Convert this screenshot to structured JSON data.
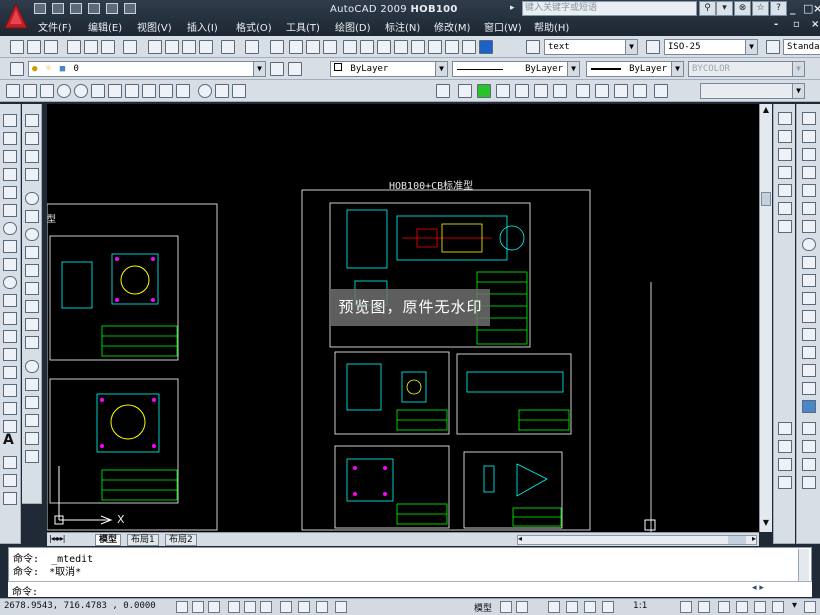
{
  "app": {
    "title_prefix": "AutoCAD 2009",
    "title_file": "HOB100",
    "search_placeholder": "键入关键字或短语"
  },
  "menu": [
    "文件(F)",
    "编辑(E)",
    "视图(V)",
    "插入(I)",
    "格式(O)",
    "工具(T)",
    "绘图(D)",
    "标注(N)",
    "修改(M)",
    "窗口(W)",
    "帮助(H)"
  ],
  "toolbar": {
    "text_style": "text",
    "dim_style": "ISO-25",
    "table_style": "Standar",
    "layer_value": "0",
    "color": "ByLayer",
    "linetype": "ByLayer",
    "lineweight": "ByLayer",
    "plotstyle": "BYCOLOR"
  },
  "drawing": {
    "sheet_title": "HOB100+CB标准型",
    "watermark": "预览图，原件无水印",
    "fragment_label": "型",
    "axis_x_label": "X"
  },
  "tabs": [
    "模型",
    "布局1",
    "布局2"
  ],
  "command": {
    "line1_label": "命令:",
    "line1_value": "_mtedit",
    "line2_label": "命令:",
    "line2_value": "*取消*",
    "prompt": "命令:"
  },
  "status": {
    "coordinates": "2678.9543, 716.4783 , 0.0000",
    "model_label": "模型",
    "scale_label": "1:1"
  },
  "colors": {
    "canvas": "#000000",
    "drawing_green": "#00ff00",
    "drawing_cyan": "#00ffff",
    "drawing_yellow": "#ffff00",
    "drawing_magenta": "#ff00ff",
    "drawing_red": "#ff0000"
  },
  "icons": [
    "app-logo-icon",
    "search-icon",
    "star-icon",
    "help-icon",
    "minimize-icon",
    "maximize-icon",
    "close-icon",
    "layer-icon",
    "color-icon",
    "line-icon",
    "circle-icon",
    "arc-icon",
    "rectangle-icon",
    "hatch-icon",
    "text-icon",
    "move-icon",
    "copy-icon",
    "rotate-icon",
    "scale-icon",
    "trim-icon",
    "extend-icon",
    "fillet-icon",
    "chamfer-icon",
    "explode-icon",
    "zoom-icon",
    "pan-icon"
  ]
}
